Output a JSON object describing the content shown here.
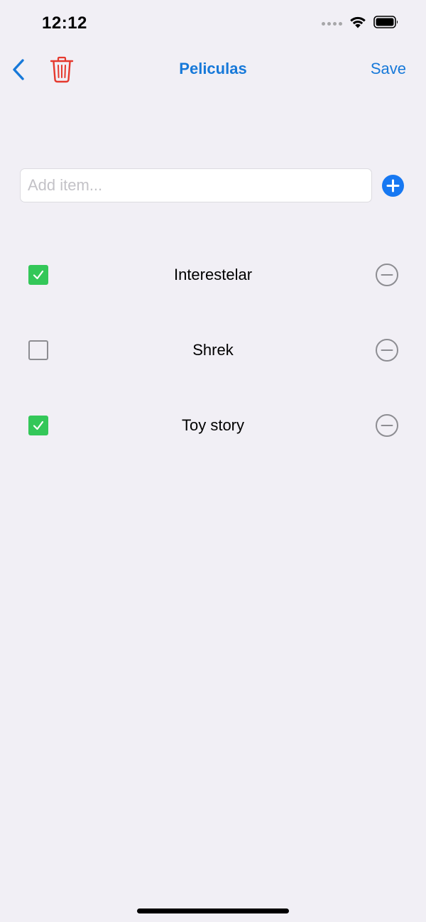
{
  "status_bar": {
    "time": "12:12",
    "icons": [
      "signal-dots-icon",
      "wifi-icon",
      "battery-icon"
    ]
  },
  "nav": {
    "back_icon": "chevron-left-icon",
    "delete_icon": "trash-icon",
    "title": "Peliculas",
    "save_label": "Save"
  },
  "add_item": {
    "placeholder": "Add item...",
    "value": "",
    "add_icon": "plus-circle-icon"
  },
  "items": [
    {
      "label": "Interestelar",
      "checked": true,
      "remove_icon": "minus-circle-icon"
    },
    {
      "label": "Shrek",
      "checked": false,
      "remove_icon": "minus-circle-icon"
    },
    {
      "label": "Toy story",
      "checked": true,
      "remove_icon": "minus-circle-icon"
    }
  ],
  "colors": {
    "accent": "#1779d9",
    "delete": "#e5392e",
    "checked": "#34c759",
    "background": "#f1eff5",
    "add_button": "#1778f2"
  }
}
